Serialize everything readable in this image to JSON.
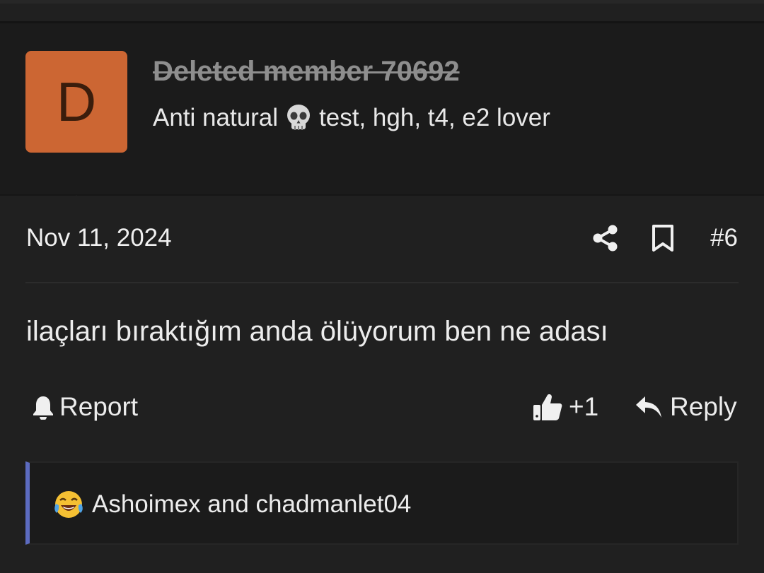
{
  "user": {
    "avatar_letter": "D",
    "avatar_color": "#cc6633",
    "name": "Deleted member 70692",
    "title_before": "Anti natural",
    "title_icon": "skull-emoji",
    "title_after": "test, hgh, t4, e2 lover"
  },
  "post": {
    "date": "Nov 11, 2024",
    "number": "#6",
    "body": "ilaçları bıraktığım anda ölüyorum ben ne adası"
  },
  "actions": {
    "report_label": "Report",
    "like_count": "+1",
    "reply_label": "Reply"
  },
  "reactions": {
    "icon": "crying-laughing-emoji",
    "users": "Ashoimex and chadmanlet04"
  },
  "colors": {
    "accent_bar": "#5c6bc0",
    "background": "#202020"
  }
}
